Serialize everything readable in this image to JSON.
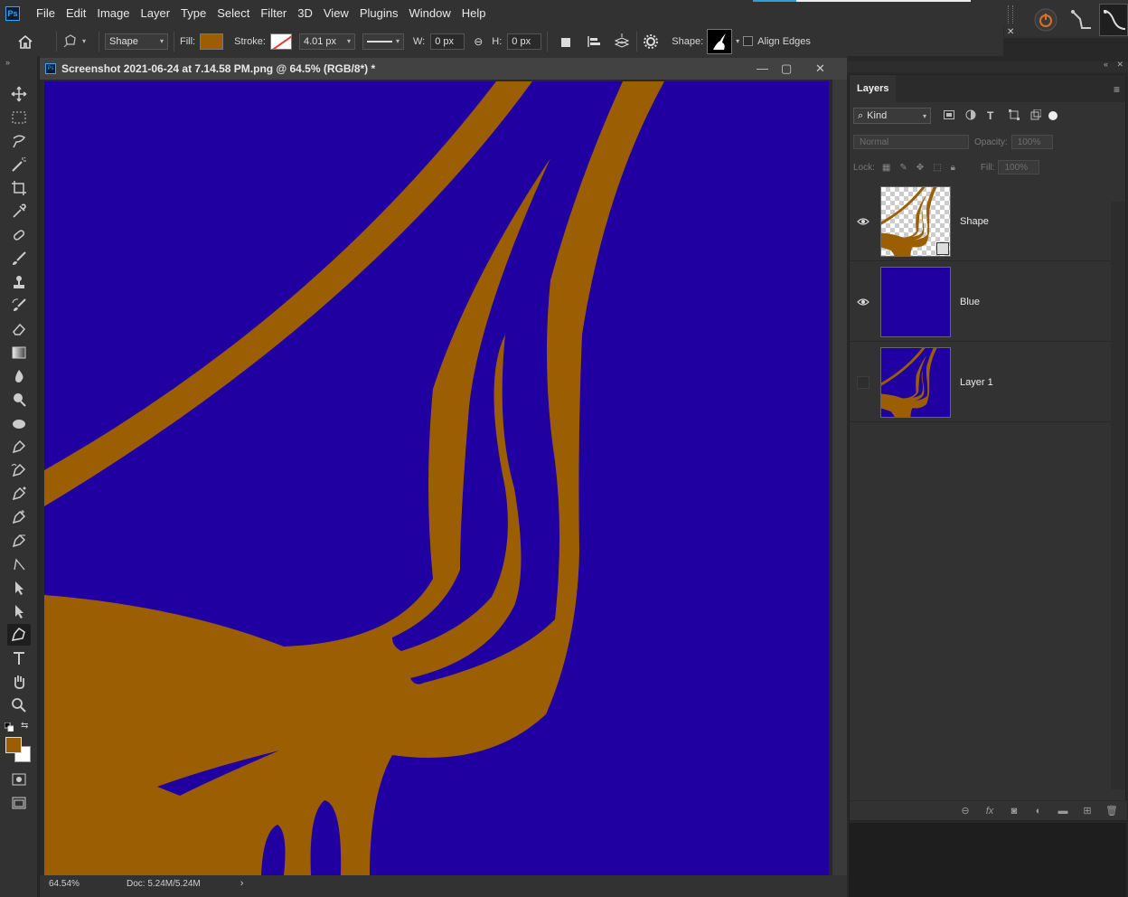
{
  "app": {
    "logo": "Ps",
    "menu": [
      "File",
      "Edit",
      "Image",
      "Layer",
      "Type",
      "Select",
      "Filter",
      "3D",
      "View",
      "Plugins",
      "Window",
      "Help"
    ]
  },
  "options": {
    "mode": "Shape",
    "fill_label": "Fill:",
    "stroke_label": "Stroke:",
    "stroke_width": "4.01 px",
    "w_label": "W:",
    "w_value": "0 px",
    "h_label": "H:",
    "h_value": "0 px",
    "shape_label": "Shape:",
    "align_edges": "Align Edges",
    "colors": {
      "fill": "#9c5e03",
      "stroke": "#ffffff"
    }
  },
  "document": {
    "title": "Screenshot 2021-06-24 at 7.14.58 PM.png @ 64.5% (RGB/8*) *",
    "zoom": "64.54%",
    "doc_info": "Doc: 5.24M/5.24M",
    "canvas_color": "#2000a0",
    "shape_color": "#9c5e03"
  },
  "layers_panel": {
    "tab": "Layers",
    "filter_kind": "Kind",
    "blend_mode": "Normal",
    "opacity_label": "Opacity:",
    "opacity": "100%",
    "lock_label": "Lock:",
    "fill_label": "Fill:",
    "fill": "100%",
    "layers": [
      {
        "name": "Shape",
        "visible": true,
        "thumb": "shape"
      },
      {
        "name": "Blue",
        "visible": true,
        "thumb": "blue"
      },
      {
        "name": "Layer 1",
        "visible": false,
        "thumb": "image"
      }
    ]
  },
  "tools": [
    "move-icon",
    "marquee-icon",
    "lasso-icon",
    "magic-wand-icon",
    "crop-icon",
    "eyedropper-icon",
    "healing-brush-icon",
    "brush-icon",
    "clone-stamp-icon",
    "history-brush-icon",
    "eraser-icon",
    "gradient-icon",
    "blur-icon",
    "dodge-icon",
    "sponge-icon",
    "pen-icon",
    "freeform-pen-icon",
    "curvature-pen-icon",
    "add-anchor-icon",
    "delete-anchor-icon",
    "convert-point-icon",
    "path-selection-icon",
    "direct-selection-icon",
    "custom-shape-icon",
    "type-icon",
    "hand-icon",
    "zoom-icon"
  ]
}
